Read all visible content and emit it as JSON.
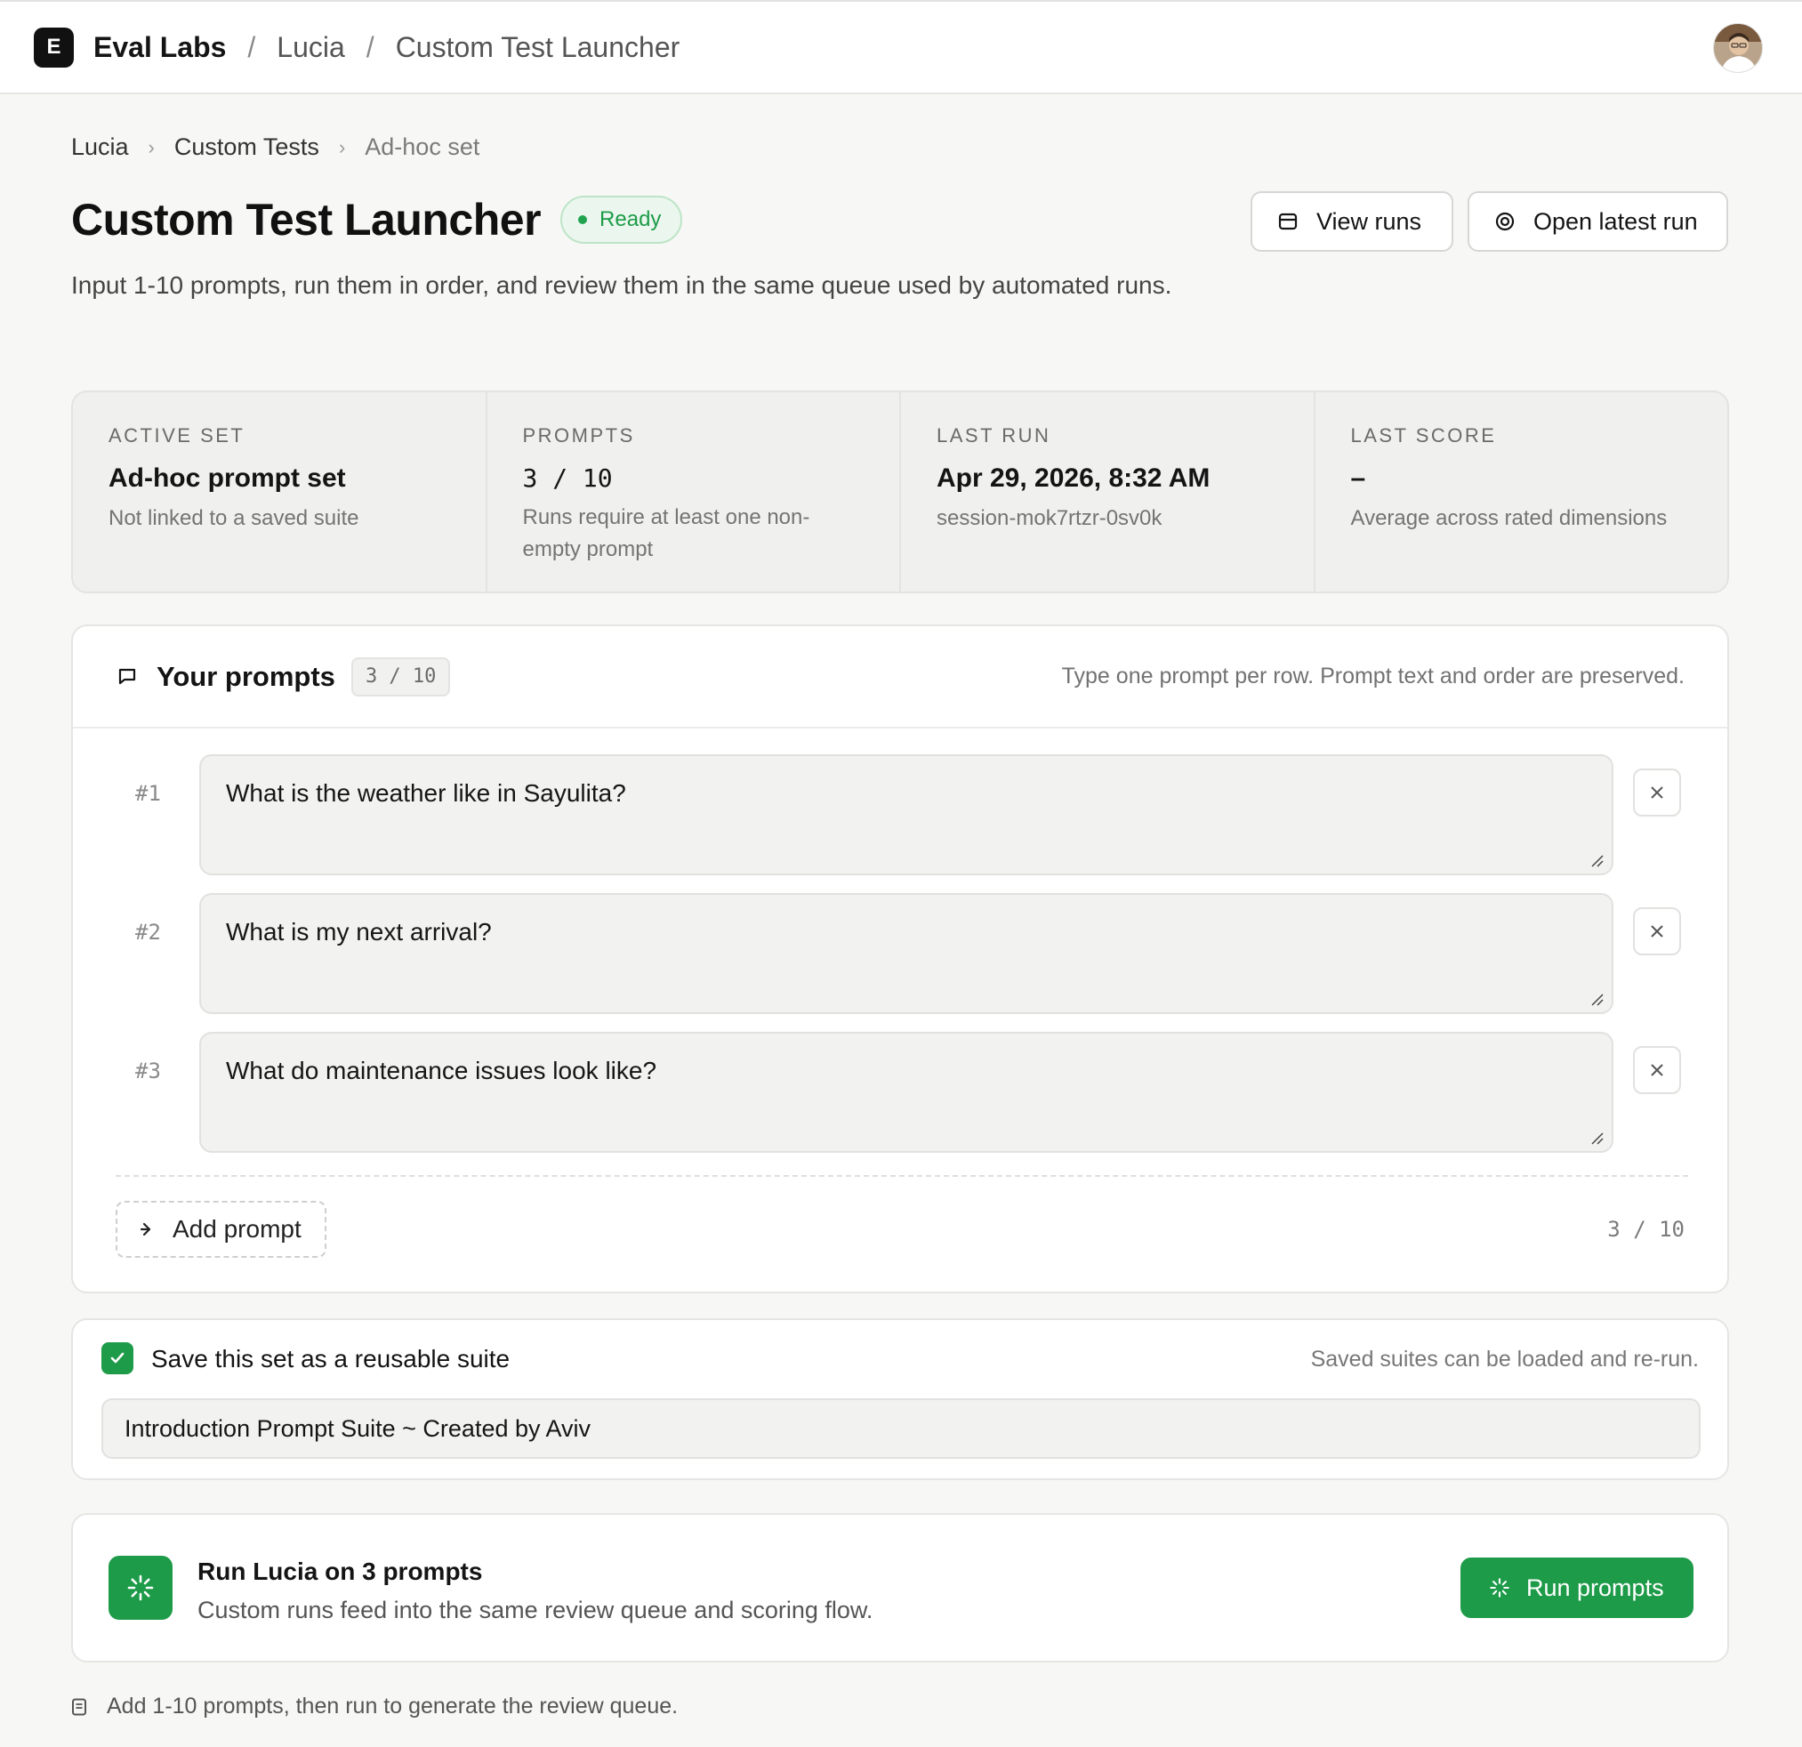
{
  "topbar": {
    "logo_letter": "E",
    "brand": "Eval Labs",
    "separator": "/",
    "crumbs": [
      "Lucia",
      "Custom Test Launcher"
    ],
    "avatar": "user-avatar"
  },
  "breadcrumb": {
    "items": [
      "Lucia",
      "Custom Tests",
      "Ad-hoc set"
    ],
    "chevron": "›"
  },
  "header": {
    "title": "Custom Test Launcher",
    "status": "Ready",
    "description": "Input 1-10 prompts, run them in order, and review them in the same queue used by automated runs.",
    "view_runs_label": "View runs",
    "open_latest_label": "Open latest run"
  },
  "stats": [
    {
      "label": "ACTIVE SET",
      "value": "Ad-hoc prompt set",
      "sub": "Not linked to a saved suite"
    },
    {
      "label": "PROMPTS",
      "value": "3 / 10",
      "sub": "Runs require at least one non-empty prompt"
    },
    {
      "label": "LAST RUN",
      "value": "Apr 29, 2026, 8:32 AM",
      "sub": "session-mok7rtzr-0sv0k"
    },
    {
      "label": "LAST SCORE",
      "value": "–",
      "sub": "Average across rated dimensions"
    }
  ],
  "prompts": {
    "title": "Your prompts",
    "count": "3 / 10",
    "hint": "Type one prompt per row. Prompt text and order are preserved.",
    "items": [
      {
        "num": "#1",
        "text": "What is the weather like in Sayulita?"
      },
      {
        "num": "#2",
        "text": "What is my next arrival?"
      },
      {
        "num": "#3",
        "text": "What do maintenance issues look like?"
      }
    ],
    "add_label": "Add prompt",
    "footer_count": "3 / 10"
  },
  "save": {
    "checked": true,
    "label": "Save this set as a reusable suite",
    "hint": "Saved suites can be loaded and re-run.",
    "suite_name": "Introduction Prompt Suite ~ Created by Aviv"
  },
  "run": {
    "title": "Run Lucia on 3 prompts",
    "subtitle": "Custom runs feed into the same review queue and scoring flow.",
    "button_label": "Run prompts"
  },
  "footer_note": "Add 1-10 prompts, then run to generate the review queue.",
  "colors": {
    "accent_green": "#1e9b49",
    "status_bg": "#ebf7ee",
    "page_bg": "#f7f7f5"
  }
}
